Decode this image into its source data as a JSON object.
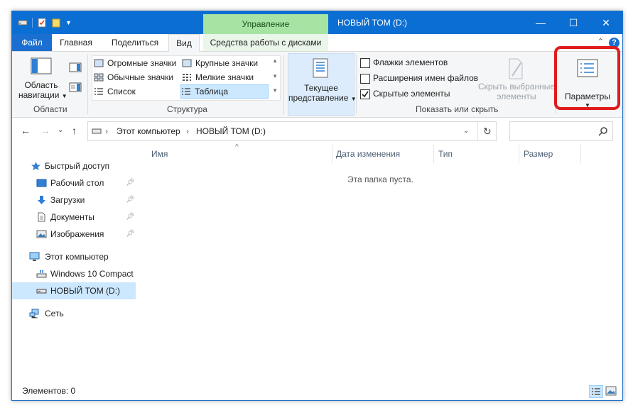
{
  "titlebar": {
    "manage_tab": "Управление",
    "title": "НОВЫЙ ТОМ (D:)",
    "minimize": "—",
    "maximize": "☐",
    "close": "✕"
  },
  "ribbon_tabs": {
    "file": "Файл",
    "home": "Главная",
    "share": "Поделиться",
    "view": "Вид",
    "drive_tools": "Средства работы с дисками",
    "help": "?"
  },
  "ribbon": {
    "panes": {
      "nav_pane_line1": "Область",
      "nav_pane_line2": "навигации",
      "group": "Области"
    },
    "layout": {
      "items": [
        "Огромные значки",
        "Крупные значки",
        "Обычные значки",
        "Мелкие значки",
        "Список",
        "Таблица"
      ],
      "selected": "Таблица",
      "group": "Структура"
    },
    "current_view": {
      "line1": "Текущее",
      "line2": "представление"
    },
    "show_hide": {
      "checkbox1": "Флажки элементов",
      "checkbox2": "Расширения имен файлов",
      "checkbox3": "Скрытые элементы",
      "hide_selected_line1": "Скрыть выбранные",
      "hide_selected_line2": "элементы",
      "group": "Показать или скрыть"
    },
    "options": "Параметры"
  },
  "address": {
    "path": [
      "Этот компьютер",
      "НОВЫЙ ТОМ (D:)"
    ]
  },
  "nav": {
    "quick_access": "Быстрый доступ",
    "desktop": "Рабочий стол",
    "downloads": "Загрузки",
    "documents": "Документы",
    "pictures": "Изображения",
    "this_pc": "Этот компьютер",
    "win10": "Windows 10 Compact",
    "new_volume": "НОВЫЙ ТОМ (D:)",
    "network": "Сеть"
  },
  "columns": {
    "name": "Имя",
    "date": "Дата изменения",
    "type": "Тип",
    "size": "Размер"
  },
  "content": {
    "empty": "Эта папка пуста."
  },
  "status": {
    "items": "Элементов: 0"
  },
  "colors": {
    "accent": "#0b6ed3",
    "manage_tab": "#a7e3a2",
    "selection": "#cce8ff",
    "highlight_frame": "#e01b1b"
  }
}
